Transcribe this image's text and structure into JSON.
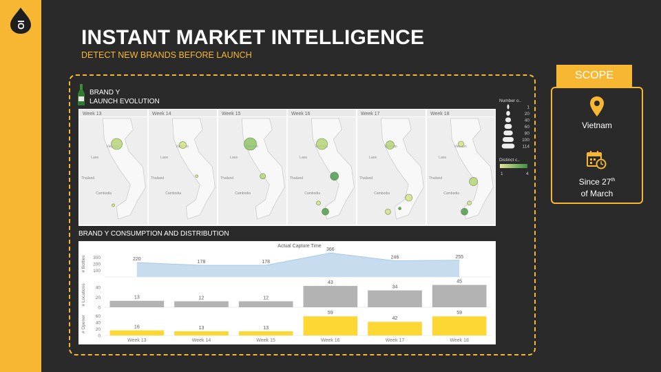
{
  "header": {
    "logo_text": "OI",
    "title": "INSTANT MARKET INTELLIGENCE",
    "subtitle": "DETECT NEW BRANDS BEFORE LAUNCH"
  },
  "brand": {
    "title_line1": "BRAND Y",
    "title_line2": "LAUNCH EVOLUTION"
  },
  "maps": {
    "weeks": [
      "Week 13",
      "Week 14",
      "Week 15",
      "Week 16",
      "Week 17",
      "Week 18"
    ],
    "place_labels": [
      "Vietnam",
      "Laos",
      "Thailand",
      "Cambodia"
    ],
    "points": [
      [
        {
          "x": 0.55,
          "y": 0.25,
          "r": 8,
          "c": 2
        },
        {
          "x": 0.5,
          "y": 0.82,
          "r": 2,
          "c": 1
        }
      ],
      [
        {
          "x": 0.5,
          "y": 0.26,
          "r": 5,
          "c": 1
        },
        {
          "x": 0.7,
          "y": 0.55,
          "r": 2,
          "c": 1
        }
      ],
      [
        {
          "x": 0.47,
          "y": 0.25,
          "r": 9,
          "c": 3
        },
        {
          "x": 0.65,
          "y": 0.55,
          "r": 4,
          "c": 2
        }
      ],
      [
        {
          "x": 0.5,
          "y": 0.25,
          "r": 8,
          "c": 2
        },
        {
          "x": 0.68,
          "y": 0.55,
          "r": 6,
          "c": 4
        },
        {
          "x": 0.55,
          "y": 0.88,
          "r": 5,
          "c": 4
        },
        {
          "x": 0.45,
          "y": 0.8,
          "r": 3,
          "c": 1
        }
      ],
      [
        {
          "x": 0.48,
          "y": 0.26,
          "r": 6,
          "c": 2
        },
        {
          "x": 0.75,
          "y": 0.75,
          "r": 5,
          "c": 1
        },
        {
          "x": 0.45,
          "y": 0.88,
          "r": 4,
          "c": 1
        },
        {
          "x": 0.62,
          "y": 0.85,
          "r": 2,
          "c": 4
        }
      ],
      [
        {
          "x": 0.5,
          "y": 0.25,
          "r": 4,
          "c": 1
        },
        {
          "x": 0.68,
          "y": 0.6,
          "r": 6,
          "c": 2
        },
        {
          "x": 0.55,
          "y": 0.88,
          "r": 5,
          "c": 4
        },
        {
          "x": 0.62,
          "y": 0.8,
          "r": 3,
          "c": 1
        }
      ]
    ]
  },
  "legend": {
    "size_title": "Number o..",
    "size_values": [
      "1",
      "20",
      "40",
      "60",
      "80",
      "100",
      "114"
    ],
    "color_title": "Distinct c..",
    "color_min": "1",
    "color_max": "4"
  },
  "consumption": {
    "title": "BRAND Y CONSUMPTION AND DISTRIBUTION"
  },
  "chart_data": {
    "type": "bar",
    "title": "Actual Capture Time",
    "categories": [
      "Week 13",
      "Week 14",
      "Week 15",
      "Week 16",
      "Week 17",
      "Week 18"
    ],
    "series": [
      {
        "name": "# Bottles",
        "type": "area",
        "values": [
          220,
          178,
          178,
          366,
          246,
          255
        ],
        "ticks": [
          "300",
          "200",
          "100"
        ],
        "ylim": [
          0,
          400
        ]
      },
      {
        "name": "# Locations",
        "type": "bar",
        "values": [
          13,
          12,
          12,
          43,
          34,
          45
        ],
        "ticks": [
          "40",
          "20",
          "0"
        ],
        "ylim": [
          0,
          50
        ]
      },
      {
        "name": "# Opener",
        "type": "bar",
        "values": [
          16,
          13,
          13,
          59,
          42,
          59
        ],
        "ticks": [
          "60",
          "40",
          "20",
          "0"
        ],
        "ylim": [
          0,
          70
        ]
      }
    ]
  },
  "scope": {
    "tab_label": "SCOPE",
    "location": "Vietnam",
    "since_line1": "Since 27",
    "since_sup": "th",
    "since_line2": "of March"
  },
  "colors": {
    "accent": "#f7b733",
    "background": "#2a2a2a",
    "area_fill": "#c7ddef",
    "grey_bar": "#b3b3b3",
    "yellow_bar": "#fdd835"
  }
}
